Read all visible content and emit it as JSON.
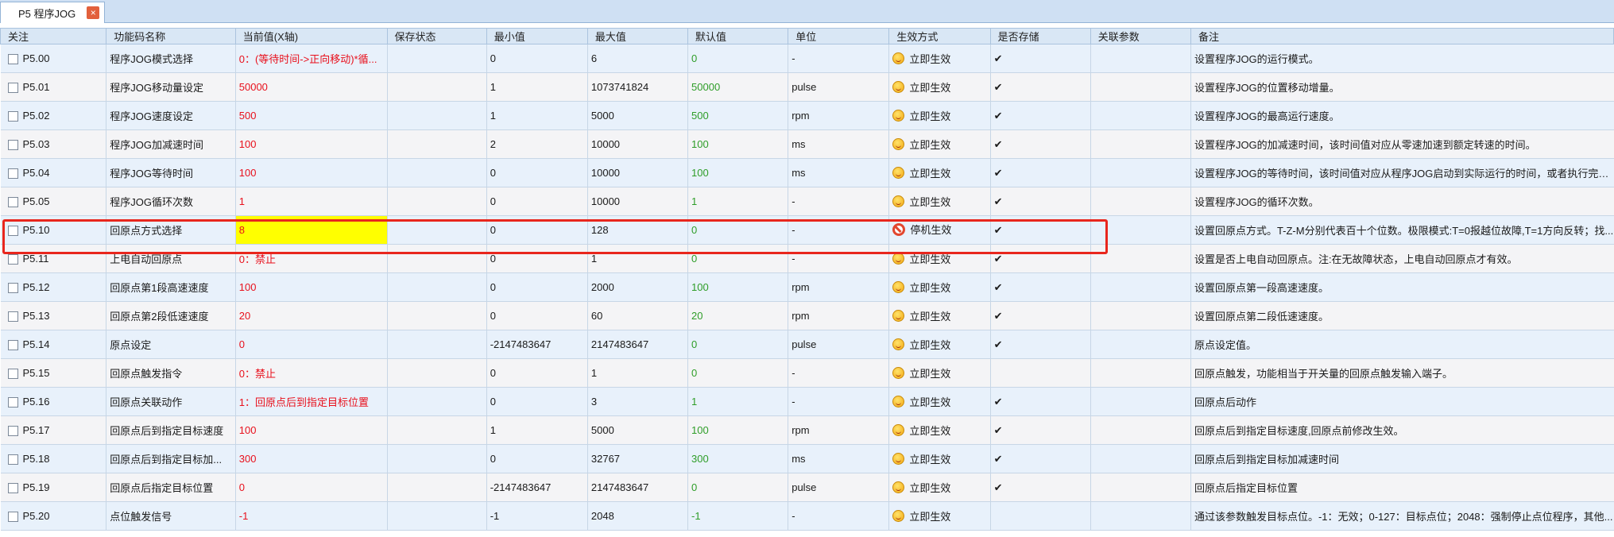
{
  "tab": {
    "label": "P5 程序JOG",
    "close_icon": "close-icon"
  },
  "columns": [
    "关注",
    "功能码名称",
    "当前值(X轴)",
    "保存状态",
    "最小值",
    "最大值",
    "默认值",
    "单位",
    "生效方式",
    "是否存储",
    "关联参数",
    "备注"
  ],
  "rows": [
    {
      "code": "P5.00",
      "name": "程序JOG模式选择",
      "current": "0：(等待时间->正向移动)*循...",
      "saved": "",
      "min": "0",
      "max": "6",
      "default": "0",
      "unit": "-",
      "effect": "立即生效",
      "effect_icon": "smile-icon",
      "stored": "✔",
      "related": "",
      "remark": "设置程序JOG的运行模式。"
    },
    {
      "code": "P5.01",
      "name": "程序JOG移动量设定",
      "current": "50000",
      "saved": "",
      "min": "1",
      "max": "1073741824",
      "default": "50000",
      "unit": "pulse",
      "effect": "立即生效",
      "effect_icon": "smile-icon",
      "stored": "✔",
      "related": "",
      "remark": "设置程序JOG的位置移动增量。"
    },
    {
      "code": "P5.02",
      "name": "程序JOG速度设定",
      "current": "500",
      "saved": "",
      "min": "1",
      "max": "5000",
      "default": "500",
      "unit": "rpm",
      "effect": "立即生效",
      "effect_icon": "smile-icon",
      "stored": "✔",
      "related": "",
      "remark": "设置程序JOG的最高运行速度。"
    },
    {
      "code": "P5.03",
      "name": "程序JOG加减速时间",
      "current": "100",
      "saved": "",
      "min": "2",
      "max": "10000",
      "default": "100",
      "unit": "ms",
      "effect": "立即生效",
      "effect_icon": "smile-icon",
      "stored": "✔",
      "related": "",
      "remark": "设置程序JOG的加减速时间，该时间值对应从零速加速到额定转速的时间。"
    },
    {
      "code": "P5.04",
      "name": "程序JOG等待时间",
      "current": "100",
      "saved": "",
      "min": "0",
      "max": "10000",
      "default": "100",
      "unit": "ms",
      "effect": "立即生效",
      "effect_icon": "smile-icon",
      "stored": "✔",
      "related": "",
      "remark": "设置程序JOG的等待时间，该时间值对应从程序JOG启动到实际运行的时间，或者执行完一..."
    },
    {
      "code": "P5.05",
      "name": "程序JOG循环次数",
      "current": "1",
      "saved": "",
      "min": "0",
      "max": "10000",
      "default": "1",
      "unit": "-",
      "effect": "立即生效",
      "effect_icon": "smile-icon",
      "stored": "✔",
      "related": "",
      "remark": "设置程序JOG的循环次数。"
    },
    {
      "code": "P5.10",
      "name": "回原点方式选择",
      "current": "8",
      "saved": "",
      "min": "0",
      "max": "128",
      "default": "0",
      "unit": "-",
      "effect": "停机生效",
      "effect_icon": "stop-icon",
      "stored": "✔",
      "related": "",
      "remark": "设置回原点方式。T-Z-M分别代表百十个位数。极限模式:T=0报越位故障,T=1方向反转；找..."
    },
    {
      "code": "P5.11",
      "name": "上电自动回原点",
      "current": "0：禁止",
      "saved": "",
      "min": "0",
      "max": "1",
      "default": "0",
      "unit": "-",
      "effect": "立即生效",
      "effect_icon": "smile-icon",
      "stored": "✔",
      "related": "",
      "remark": "设置是否上电自动回原点。注:在无故障状态，上电自动回原点才有效。"
    },
    {
      "code": "P5.12",
      "name": "回原点第1段高速速度",
      "current": "100",
      "saved": "",
      "min": "0",
      "max": "2000",
      "default": "100",
      "unit": "rpm",
      "effect": "立即生效",
      "effect_icon": "smile-icon",
      "stored": "✔",
      "related": "",
      "remark": "设置回原点第一段高速速度。"
    },
    {
      "code": "P5.13",
      "name": "回原点第2段低速速度",
      "current": "20",
      "saved": "",
      "min": "0",
      "max": "60",
      "default": "20",
      "unit": "rpm",
      "effect": "立即生效",
      "effect_icon": "smile-icon",
      "stored": "✔",
      "related": "",
      "remark": "设置回原点第二段低速速度。"
    },
    {
      "code": "P5.14",
      "name": "原点设定",
      "current": "0",
      "saved": "",
      "min": "-2147483647",
      "max": "2147483647",
      "default": "0",
      "unit": "pulse",
      "effect": "立即生效",
      "effect_icon": "smile-icon",
      "stored": "✔",
      "related": "",
      "remark": "原点设定值。"
    },
    {
      "code": "P5.15",
      "name": "回原点触发指令",
      "current": "0：禁止",
      "saved": "",
      "min": "0",
      "max": "1",
      "default": "0",
      "unit": "-",
      "effect": "立即生效",
      "effect_icon": "smile-icon",
      "stored": "",
      "related": "",
      "remark": "回原点触发，功能相当于开关量的回原点触发输入端子。"
    },
    {
      "code": "P5.16",
      "name": "回原点关联动作",
      "current": "1：回原点后到指定目标位置",
      "saved": "",
      "min": "0",
      "max": "3",
      "default": "1",
      "unit": "-",
      "effect": "立即生效",
      "effect_icon": "smile-icon",
      "stored": "✔",
      "related": "",
      "remark": "回原点后动作"
    },
    {
      "code": "P5.17",
      "name": "回原点后到指定目标速度",
      "current": "100",
      "saved": "",
      "min": "1",
      "max": "5000",
      "default": "100",
      "unit": "rpm",
      "effect": "立即生效",
      "effect_icon": "smile-icon",
      "stored": "✔",
      "related": "",
      "remark": "回原点后到指定目标速度,回原点前修改生效。"
    },
    {
      "code": "P5.18",
      "name": "回原点后到指定目标加...",
      "current": "300",
      "saved": "",
      "min": "0",
      "max": "32767",
      "default": "300",
      "unit": "ms",
      "effect": "立即生效",
      "effect_icon": "smile-icon",
      "stored": "✔",
      "related": "",
      "remark": "回原点后到指定目标加减速时间"
    },
    {
      "code": "P5.19",
      "name": "回原点后指定目标位置",
      "current": "0",
      "saved": "",
      "min": "-2147483647",
      "max": "2147483647",
      "default": "0",
      "unit": "pulse",
      "effect": "立即生效",
      "effect_icon": "smile-icon",
      "stored": "✔",
      "related": "",
      "remark": "回原点后指定目标位置"
    },
    {
      "code": "P5.20",
      "name": "点位触发信号",
      "current": "-1",
      "saved": "",
      "min": "-1",
      "max": "2048",
      "default": "-1",
      "unit": "-",
      "effect": "立即生效",
      "effect_icon": "smile-icon",
      "stored": "",
      "related": "",
      "remark": "通过该参数触发目标点位。-1：无效；0-127：目标点位；2048：强制停止点位程序，其他..."
    }
  ],
  "highlighted_row": "P5.10",
  "colors": {
    "header_bg": "#d9e7f5",
    "row_odd": "#e8f1fb",
    "row_even": "#f4f4f6",
    "value_red": "#e8101c",
    "value_green": "#2e9d28",
    "highlight_yellow": "#ffff00",
    "highlight_border": "#e8261d"
  }
}
